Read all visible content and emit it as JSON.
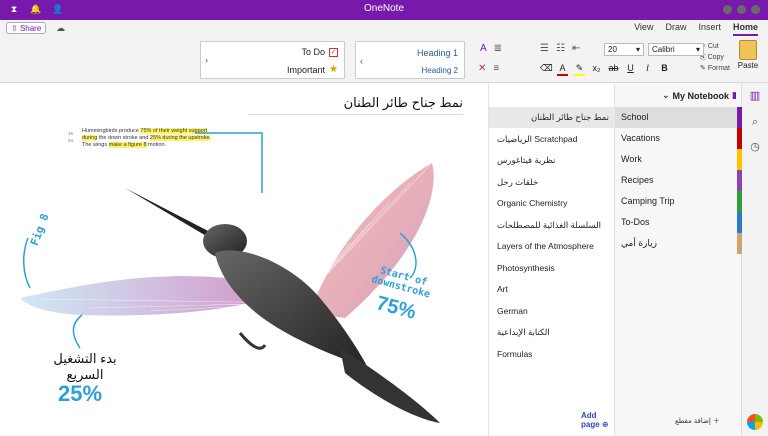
{
  "window": {
    "title": "OneNote"
  },
  "ribbon_tabs": {
    "tabs": [
      "Home",
      "Insert",
      "Draw",
      "View"
    ],
    "active": "Home",
    "share_label": "Share"
  },
  "ribbon": {
    "paste_label": "Paste",
    "clipboard": [
      "Cut",
      "Copy",
      "Format"
    ],
    "font_name": "Calibri",
    "font_size": "20",
    "styles": {
      "heading1": "Heading 1",
      "heading2": "Heading 2"
    },
    "tags": {
      "todo": "To Do",
      "important": "Important"
    }
  },
  "notebook": {
    "name": "My Notebook",
    "sections": [
      {
        "label": "School",
        "color": "#7719aa"
      },
      {
        "label": "Vacations",
        "color": "#c00000"
      },
      {
        "label": "Work",
        "color": "#ffc000"
      },
      {
        "label": "Recipes",
        "color": "#8e44ad"
      },
      {
        "label": "Camping Trip",
        "color": "#2e9d3f"
      },
      {
        "label": "To-Dos",
        "color": "#2f78c4"
      },
      {
        "label": "زيارة أمي",
        "color": "#d4a373"
      }
    ],
    "add_section": "إضافة مقطع"
  },
  "pages": {
    "items": [
      "نمط جناح طائر الطنان",
      "الرياضيات Scratchpad",
      "نظرية فيثاغورس",
      "خلقات رحل",
      "Organic Chemistry",
      "السلسلة الغذائية للمصطلحات",
      "Layers of the Atmosphere",
      "Photosynthesis",
      "Art",
      "German",
      "الكتابة الإبداعية",
      "Formulas"
    ],
    "add_page": "Add page"
  },
  "canvas": {
    "page_title": "نمط جناح طائر الطنان",
    "caption_line1": "Hummingbirds produce ",
    "caption_hl1": "75% of their weight support during",
    "caption_line2": "the down stroke and ",
    "caption_hl2": "25% during the upstroke",
    "caption_line3": "The wings ",
    "caption_hl3": "make a figure 8",
    "caption_line4": " motion.",
    "caption_nums": [
      "16",
      "",
      "04"
    ],
    "fig_label": "Fig 8",
    "downstroke_label_1": "Start of",
    "downstroke_label_2": "downstroke",
    "downstroke_pct": "75%",
    "upstroke_label": "بدء التشغيل السريع",
    "upstroke_pct": "25%"
  }
}
